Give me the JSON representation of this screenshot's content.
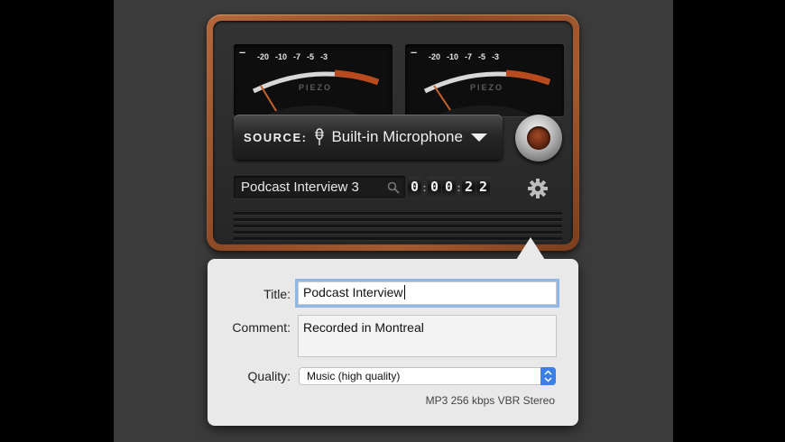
{
  "meters": {
    "left": {
      "minus": "–",
      "scale": [
        "-20",
        "-10",
        "-7",
        "-5",
        "-3"
      ],
      "brand": "PIEZO"
    },
    "right": {
      "minus": "–",
      "scale": [
        "-20",
        "-10",
        "-7",
        "-5",
        "-3"
      ],
      "brand": "PIEZO"
    }
  },
  "source": {
    "label": "SOURCE:",
    "value": "Built-in Microphone",
    "mic_icon": "microphone-icon",
    "dropdown_icon": "triangle-down-icon"
  },
  "record_button": {
    "icon": "record-knob"
  },
  "recording": {
    "name": "Podcast Interview 3",
    "search_icon": "magnifier-icon",
    "timer": [
      "0",
      "0",
      "0",
      "2",
      "2"
    ]
  },
  "settings_icon": "gear-icon",
  "popover": {
    "title_label": "Title:",
    "title_value": "Podcast Interview",
    "comment_label": "Comment:",
    "comment_value": "Recorded in Montreal",
    "quality_label": "Quality:",
    "quality_value": "Music (high quality)",
    "format_note": "MP3 256 kbps VBR Stereo"
  },
  "colors": {
    "wood": "#9a5530",
    "face": "#2b2b2b",
    "accent_blue": "#3a80e8",
    "popover_bg": "#e9e9e9"
  }
}
